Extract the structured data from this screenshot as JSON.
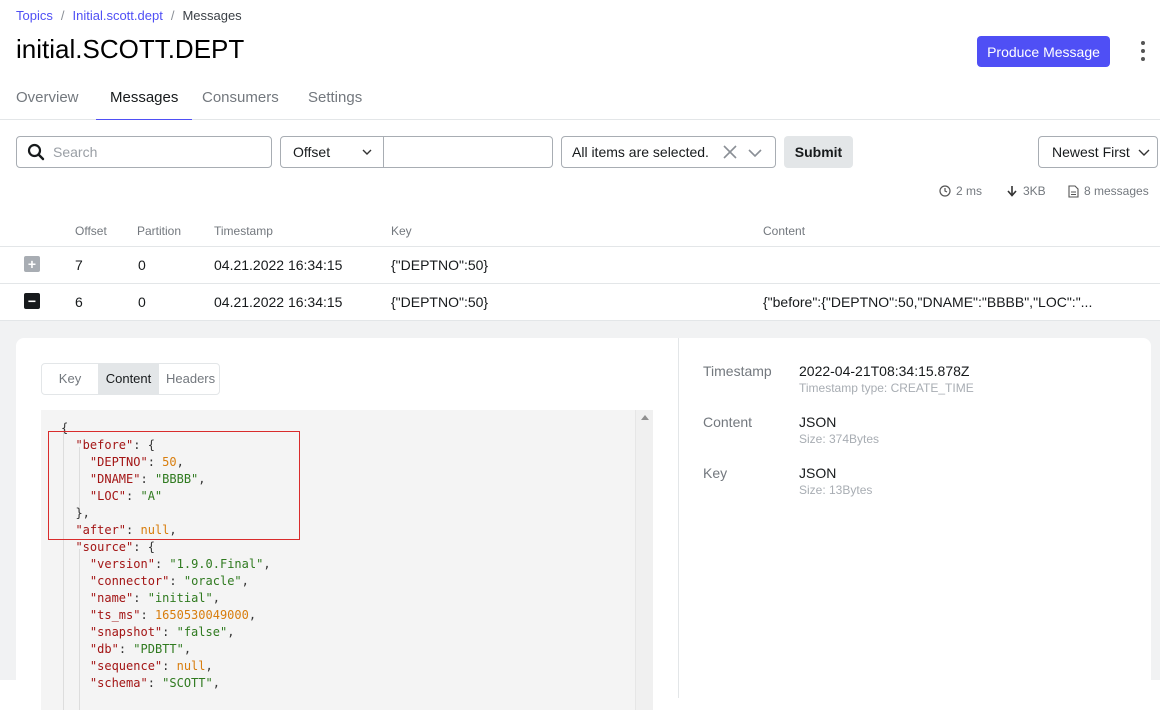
{
  "breadcrumb": {
    "items": [
      "Topics",
      "Initial.scott.dept"
    ],
    "current": "Messages",
    "separator": "/"
  },
  "page": {
    "title": "initial.SCOTT.DEPT"
  },
  "header": {
    "produce_label": "Produce Message",
    "menu_icon": "more-vertical-icon"
  },
  "tabs": [
    {
      "label": "Overview",
      "active": false
    },
    {
      "label": "Messages",
      "active": true
    },
    {
      "label": "Consumers",
      "active": false
    },
    {
      "label": "Settings",
      "active": false
    }
  ],
  "filters": {
    "search_placeholder": "Search",
    "seek_type": "Offset",
    "seek_value": "",
    "partitions": "All items are selected.",
    "submit_label": "Submit",
    "sort": "Newest First"
  },
  "stats": {
    "time": "2 ms",
    "bytes": "3KB",
    "messages": "8 messages"
  },
  "table": {
    "columns": [
      "Offset",
      "Partition",
      "Timestamp",
      "Key",
      "Content"
    ],
    "rows": [
      {
        "offset": "7",
        "partition": "0",
        "timestamp": "04.21.2022 16:34:15",
        "key": "{\"DEPTNO\":50}",
        "content": "",
        "expanded": false
      },
      {
        "offset": "6",
        "partition": "0",
        "timestamp": "04.21.2022 16:34:15",
        "key": "{\"DEPTNO\":50}",
        "content": "{\"before\":{\"DEPTNO\":50,\"DNAME\":\"BBBB\",\"LOC\":\"...",
        "expanded": true
      }
    ]
  },
  "detail": {
    "tabs": [
      "Key",
      "Content",
      "Headers"
    ],
    "active_tab": "Content",
    "meta": {
      "timestamp_label": "Timestamp",
      "timestamp_value": "2022-04-21T08:34:15.878Z",
      "timestamp_type": "Timestamp type: CREATE_TIME",
      "content_label": "Content",
      "content_value": "JSON",
      "content_size": "Size: 374Bytes",
      "key_label": "Key",
      "key_value": "JSON",
      "key_size": "Size: 13Bytes"
    },
    "json_lines": [
      {
        "indent": 0,
        "tokens": [
          [
            "p",
            "{"
          ]
        ]
      },
      {
        "indent": 1,
        "tokens": [
          [
            "k",
            "\"before\""
          ],
          [
            "p",
            ": {"
          ]
        ]
      },
      {
        "indent": 2,
        "tokens": [
          [
            "k",
            "\"DEPTNO\""
          ],
          [
            "p",
            ": "
          ],
          [
            "n",
            "50"
          ],
          [
            "p",
            ","
          ]
        ]
      },
      {
        "indent": 2,
        "tokens": [
          [
            "k",
            "\"DNAME\""
          ],
          [
            "p",
            ": "
          ],
          [
            "s",
            "\"BBBB\""
          ],
          [
            "p",
            ","
          ]
        ]
      },
      {
        "indent": 2,
        "tokens": [
          [
            "k",
            "\"LOC\""
          ],
          [
            "p",
            ": "
          ],
          [
            "s",
            "\"A\""
          ]
        ]
      },
      {
        "indent": 1,
        "tokens": [
          [
            "p",
            "},"
          ]
        ]
      },
      {
        "indent": 1,
        "tokens": [
          [
            "k",
            "\"after\""
          ],
          [
            "p",
            ": "
          ],
          [
            "nl",
            "null"
          ],
          [
            "p",
            ","
          ]
        ]
      },
      {
        "indent": 1,
        "tokens": [
          [
            "k",
            "\"source\""
          ],
          [
            "p",
            ": {"
          ]
        ]
      },
      {
        "indent": 2,
        "tokens": [
          [
            "k",
            "\"version\""
          ],
          [
            "p",
            ": "
          ],
          [
            "s",
            "\"1.9.0.Final\""
          ],
          [
            "p",
            ","
          ]
        ]
      },
      {
        "indent": 2,
        "tokens": [
          [
            "k",
            "\"connector\""
          ],
          [
            "p",
            ": "
          ],
          [
            "s",
            "\"oracle\""
          ],
          [
            "p",
            ","
          ]
        ]
      },
      {
        "indent": 2,
        "tokens": [
          [
            "k",
            "\"name\""
          ],
          [
            "p",
            ": "
          ],
          [
            "s",
            "\"initial\""
          ],
          [
            "p",
            ","
          ]
        ]
      },
      {
        "indent": 2,
        "tokens": [
          [
            "k",
            "\"ts_ms\""
          ],
          [
            "p",
            ": "
          ],
          [
            "n",
            "1650530049000"
          ],
          [
            "p",
            ","
          ]
        ]
      },
      {
        "indent": 2,
        "tokens": [
          [
            "k",
            "\"snapshot\""
          ],
          [
            "p",
            ": "
          ],
          [
            "s",
            "\"false\""
          ],
          [
            "p",
            ","
          ]
        ]
      },
      {
        "indent": 2,
        "tokens": [
          [
            "k",
            "\"db\""
          ],
          [
            "p",
            ": "
          ],
          [
            "s",
            "\"PDBTT\""
          ],
          [
            "p",
            ","
          ]
        ]
      },
      {
        "indent": 2,
        "tokens": [
          [
            "k",
            "\"sequence\""
          ],
          [
            "p",
            ": "
          ],
          [
            "nl",
            "null"
          ],
          [
            "p",
            ","
          ]
        ]
      },
      {
        "indent": 2,
        "tokens": [
          [
            "k",
            "\"schema\""
          ],
          [
            "p",
            ": "
          ],
          [
            "s",
            "\"SCOTT\""
          ],
          [
            "p",
            ","
          ]
        ]
      }
    ]
  }
}
